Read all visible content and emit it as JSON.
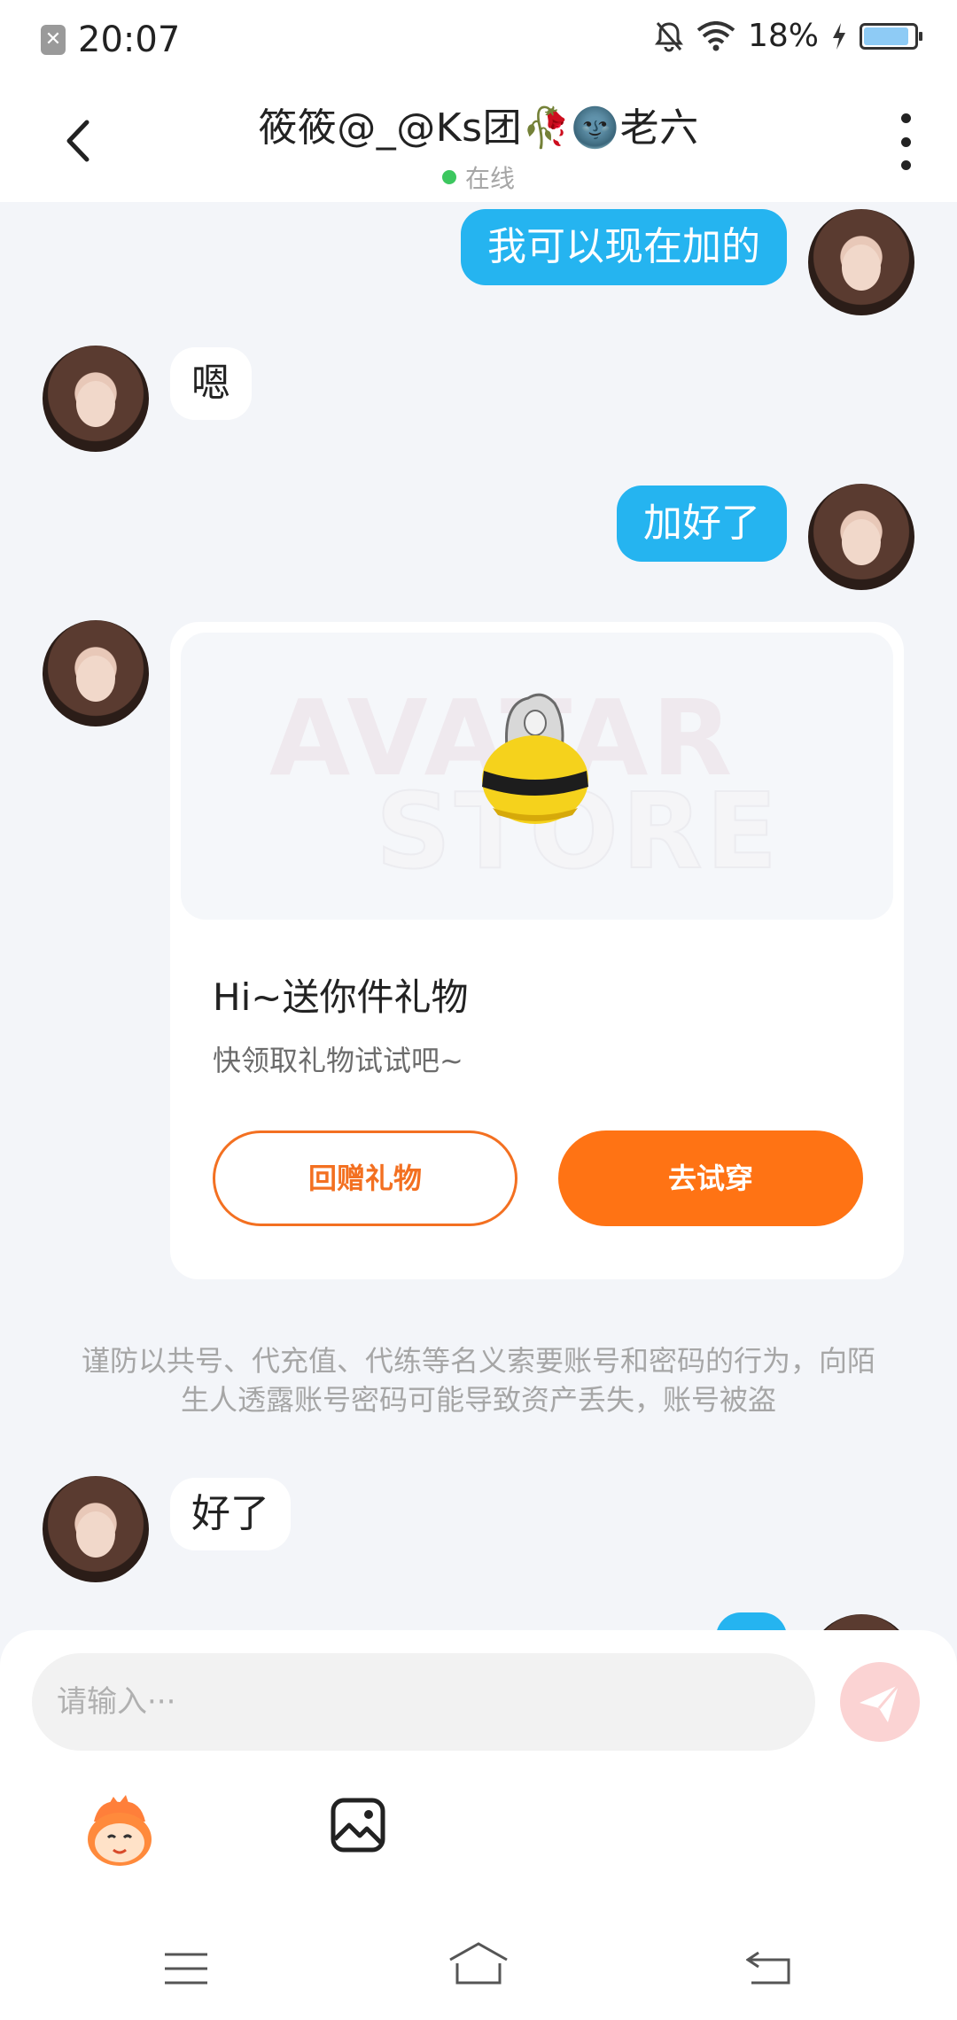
{
  "status_bar": {
    "time": "20:07",
    "battery_percent": "18%",
    "battery_level": 0.18,
    "icons": [
      "notification-icon",
      "mute-icon",
      "wifi-icon",
      "charging-icon",
      "battery-icon"
    ]
  },
  "header": {
    "title": "筱筱@_@Ks团🥀🌚老六",
    "status": "在线",
    "status_color": "#3cc75f"
  },
  "messages": {
    "m1": "我可以现在加的",
    "m2": "嗯",
    "m3": "加好了",
    "m5": "好了"
  },
  "gift_card": {
    "watermark_line1": "AVATAR",
    "watermark_line2": "STORE",
    "title": "Hi~送你件礼物",
    "subtitle": "快领取礼物试试吧~",
    "return_button": "回赠礼物",
    "try_button": "去试穿"
  },
  "system_notice": "谨防以共号、代充值、代练等名义索要账号和密码的行为，向陌生人透露账号密码可能导致资产丢失，账号被盗",
  "input": {
    "placeholder": "请输入···"
  },
  "colors": {
    "accent_blue": "#25b4f0",
    "accent_orange": "#ff7314",
    "background": "#f3f5f9"
  }
}
